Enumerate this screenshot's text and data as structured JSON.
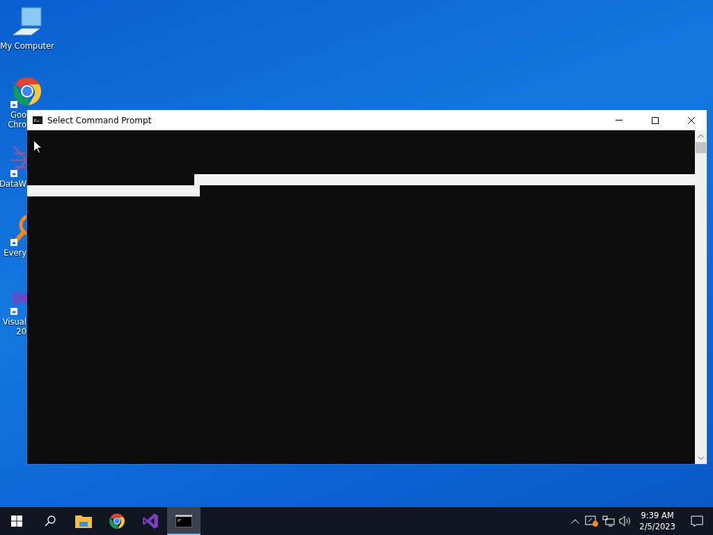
{
  "desktop": {
    "icons": [
      {
        "kind": "computer",
        "lines": [
          "My Computer"
        ],
        "partly_hidden": false
      },
      {
        "kind": "chrome",
        "lines": [
          "Goo",
          "Chro"
        ],
        "partly_hidden": true
      },
      {
        "kind": "datawrapper",
        "lines": [
          "DataW"
        ],
        "partly_hidden": true
      },
      {
        "kind": "everything",
        "lines": [
          "Every"
        ],
        "partly_hidden": true
      },
      {
        "kind": "visualstudio",
        "lines": [
          "Visual",
          "20"
        ],
        "partly_hidden": true
      }
    ]
  },
  "window": {
    "title": "Select Command Prompt"
  },
  "taskbar": {
    "apps": [
      {
        "kind": "explorer",
        "selected": false
      },
      {
        "kind": "chrome",
        "selected": false
      },
      {
        "kind": "visualstudio",
        "selected": false
      },
      {
        "kind": "console",
        "selected": true
      }
    ],
    "time": "9:39 AM",
    "date": "2/5/2023"
  }
}
